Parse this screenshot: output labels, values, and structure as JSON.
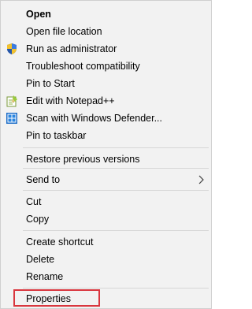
{
  "menu": {
    "items": [
      {
        "label": "Open"
      },
      {
        "label": "Open file location"
      },
      {
        "label": "Run as administrator",
        "icon": "uac-shield-icon"
      },
      {
        "label": "Troubleshoot compatibility"
      },
      {
        "label": "Pin to Start"
      },
      {
        "label": "Edit with Notepad++",
        "icon": "notepad-plus-plus-icon"
      },
      {
        "label": "Scan with Windows Defender...",
        "icon": "windows-defender-icon"
      },
      {
        "label": "Pin to taskbar"
      },
      {
        "label": "Restore previous versions"
      },
      {
        "label": "Send to",
        "icon": "chevron-right-icon"
      },
      {
        "label": "Cut"
      },
      {
        "label": "Copy"
      },
      {
        "label": "Create shortcut"
      },
      {
        "label": "Delete"
      },
      {
        "label": "Rename"
      },
      {
        "label": "Properties"
      }
    ]
  },
  "colors": {
    "menu_background": "#f2f2f2",
    "separator": "#d7d7d7",
    "highlight_border": "#d9363e"
  }
}
